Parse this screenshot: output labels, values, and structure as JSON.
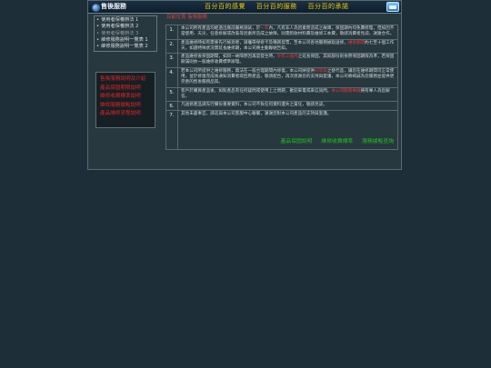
{
  "header": {
    "site_title": "售後服務",
    "slogan": [
      "百分百的感覺",
      "百分百的服務",
      "百分百的承諾"
    ]
  },
  "sidebar": {
    "menu": [
      {
        "label": "使用者保養辦法 1",
        "dim": false
      },
      {
        "label": "使用者保養辦法 2",
        "dim": false
      },
      {
        "label": "使用者保養辦法 3",
        "dim": true
      },
      {
        "label": "維修服務說明一覽表 1",
        "dim": false
      },
      {
        "label": "維修服務說明一覽表 2",
        "dim": false
      }
    ],
    "promo": [
      "售後服務說明及介紹",
      "產品保固期限說明",
      "維修收費標準說明",
      "維修服務據點說明",
      "產品維修流程說明"
    ]
  },
  "main": {
    "breadcrumb": "目前位置 售後服務",
    "items": [
      {
        "num": "1.",
        "pre": "本公司所有產品均經過出廠前嚴格測試，於",
        "hl": "一年",
        "post": "內，凡有非人為因素而造成之故障，保固期內均免費修理，但如因不當使用、天災、任意拆解或改裝等因素所造成之故障，則需酌收材料費及維修工本費，敬請消費者見諒，謝謝合作。"
      },
      {
        "num": "2.",
        "pre": "產品維修時如有需要先行檢測者，請攜帶保修卡及購買發票，至本公司各地服務據點送修，",
        "hl": "維修期間",
        "post": "約七至十個工作天，如遇特殊狀況需延長維修期，本公司將主動聯絡告知。"
      },
      {
        "num": "3.",
        "pre": "產品維修後保固期間，如同一故障原因再度發生時，",
        "hl": "享有三個月",
        "post": "之延長保固，其餘部份則依原保固期限為準，若保固期滿則依一般維修收費標準辦理。"
      },
      {
        "num": "4.",
        "pre": "若本公司所提供之維修服務，無法在一般合理期間內修復，本公司將提供",
        "hl": "同等級",
        "post": "之替代品，讓您在維修期間可正常使用，並於修復完成後通知消費者取回原產品，敬請配合，再次感謝您的支持與愛護，本公司將竭誠為您服務並提供更完善的售後服務品質。"
      },
      {
        "num": "5.",
        "pre": "客戶於購買產品後，如對產品有任何疑問或使用上之問題，歡迎來電或來信詢問，",
        "hl": "本公司服務專線",
        "post": "將有專人為您解答。"
      },
      {
        "num": "6.",
        "pre": "凡送修產品請先行備份重要資料，本公司不負任何資料遺失之責任，敬請見諒。",
        "hl": "",
        "post": ""
      },
      {
        "num": "7.",
        "pre": "其他未盡事宜，請逕與本公司客服中心聯繫，謝謝您對本公司產品的支持與愛護。",
        "hl": "",
        "post": ""
      }
    ],
    "links": [
      "產品保固說明",
      "維修收費標準",
      "服務據點查詢"
    ]
  },
  "colors": {
    "background": "#1d2e39",
    "accent_yellow": "#f0c800",
    "highlight_red": "#e83a3a",
    "link_green": "#20c020"
  },
  "icons": {
    "logo": "globe-dot-icon",
    "corner": "mail-icon"
  }
}
